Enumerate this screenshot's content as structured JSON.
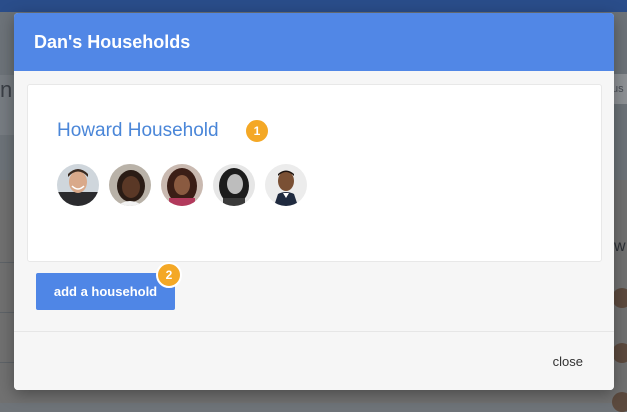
{
  "modal": {
    "title": "Dan's Households",
    "household": {
      "name": "Howard Household",
      "badge": "1",
      "members": [
        {
          "avatar": "member-avatar-1"
        },
        {
          "avatar": "member-avatar-2"
        },
        {
          "avatar": "member-avatar-3"
        },
        {
          "avatar": "member-avatar-4"
        },
        {
          "avatar": "member-avatar-5"
        }
      ]
    },
    "add_household": {
      "label": "add a household",
      "badge": "2"
    },
    "close_label": "close"
  },
  "background": {
    "left_fragment": "n",
    "right_fragment": "us",
    "right_letter": "w"
  },
  "colors": {
    "header": "#5187e6",
    "accent": "#4f86e6",
    "link": "#4a86d8",
    "badge": "#f4a826"
  }
}
